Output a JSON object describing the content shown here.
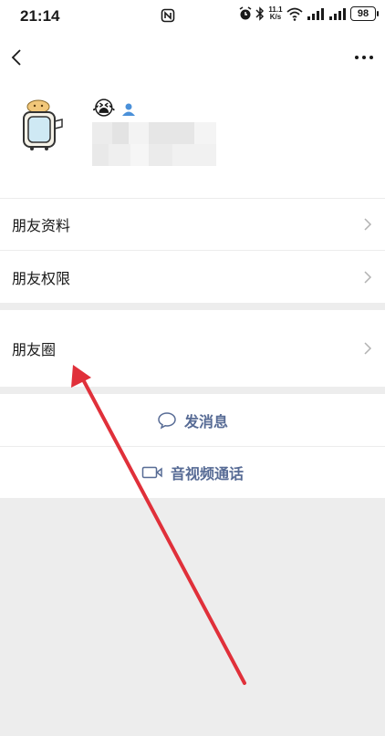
{
  "status_bar": {
    "time": "21:14",
    "net_speed_value": "11.1",
    "net_speed_unit": "K/s",
    "battery": "98"
  },
  "nav": {
    "back_icon": "chevron-left-icon",
    "more_icon": "more-dots-icon"
  },
  "profile": {
    "avatar_icon": "mirror-avatar-icon",
    "name_emoji": "😭",
    "gender_icon": "person-icon"
  },
  "menu": {
    "friend_info": "朋友资料",
    "friend_permissions": "朋友权限",
    "moments": "朋友圈"
  },
  "actions": {
    "send_message": "发消息",
    "video_call": "音视频通话"
  },
  "colors": {
    "link_blue": "#576b95",
    "annotation_red": "#e0303a"
  }
}
